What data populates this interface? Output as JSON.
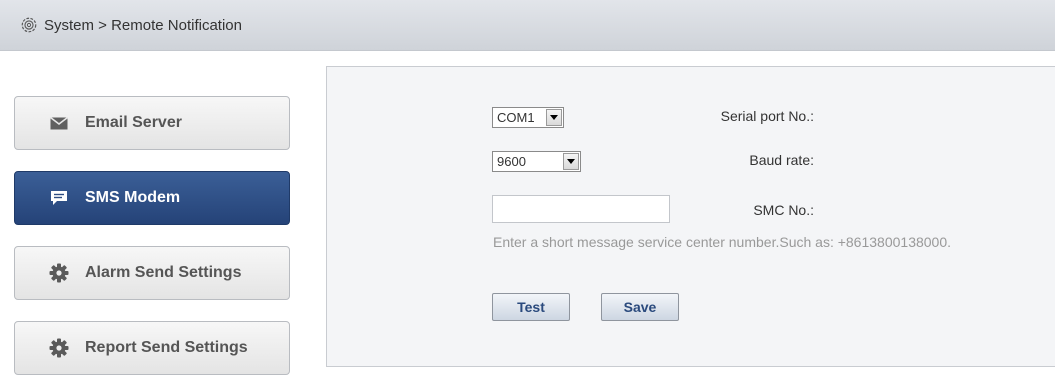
{
  "titlebar": {
    "title": "System > Remote Notification",
    "icon": "gear-outline-icon"
  },
  "sidebar": {
    "items": [
      {
        "label": "Email Server",
        "icon": "envelope-icon",
        "active": false
      },
      {
        "label": "SMS Modem",
        "icon": "chat-bubble-icon",
        "active": true
      },
      {
        "label": "Alarm Send Settings",
        "icon": "gear-icon",
        "active": false
      },
      {
        "label": "Report Send Settings",
        "icon": "gear-icon",
        "active": false
      }
    ]
  },
  "form": {
    "serial_port": {
      "label": "Serial port No.:",
      "value": "COM1"
    },
    "baud_rate": {
      "label": "Baud rate:",
      "value": "9600"
    },
    "smc": {
      "label": "SMC No.:",
      "value": "",
      "hint": "Enter a short message service center number.Such as: +8613800138000."
    },
    "test_label": "Test",
    "save_label": "Save"
  },
  "colors": {
    "active_nav": "#2d4c82",
    "button_text": "#2a4a7d",
    "panel_bg": "#f4f5f7"
  }
}
